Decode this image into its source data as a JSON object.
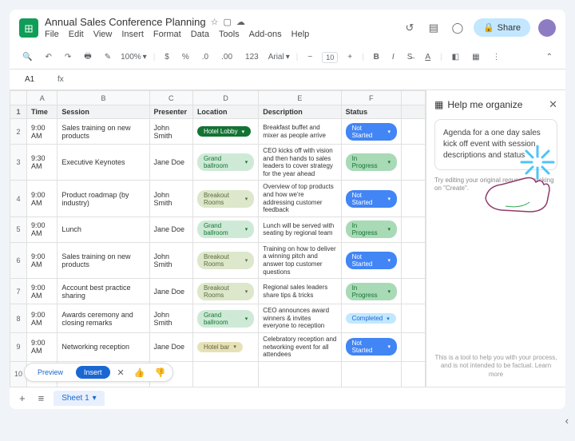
{
  "doc_title": "Annual Sales Conference Planning",
  "menus": [
    "File",
    "Edit",
    "View",
    "Insert",
    "Format",
    "Data",
    "Tools",
    "Add-ons",
    "Help"
  ],
  "share": "Share",
  "zoom": "100%",
  "font": "Arial",
  "fontsize": "10",
  "cellref": "A1",
  "columns": [
    "A",
    "B",
    "C",
    "D",
    "E",
    "F"
  ],
  "headers": {
    "time": "Time",
    "session": "Session",
    "presenter": "Presenter",
    "location": "Location",
    "description": "Description",
    "status": "Status"
  },
  "rows": [
    {
      "n": "2",
      "time": "9:00 AM",
      "session": "Sales training on new products",
      "presenter": "John Smith",
      "loc": "Hotel Lobby",
      "locClass": "loc-lobby",
      "desc": "Breakfast buffet and mixer as people arrive",
      "status": "Not Started",
      "stClass": "st-notstarted"
    },
    {
      "n": "3",
      "time": "9:30 AM",
      "session": "Executive Keynotes",
      "presenter": "Jane Doe",
      "loc": "Grand ballroom",
      "locClass": "loc-ballroom",
      "desc": "CEO kicks off with vision and then hands to sales leaders to cover strategy for the year ahead",
      "status": "In Progress",
      "stClass": "st-inprogress"
    },
    {
      "n": "4",
      "time": "9:00 AM",
      "session": "Product roadmap (by industry)",
      "presenter": "John Smith",
      "loc": "Breakout Rooms",
      "locClass": "loc-breakout",
      "desc": "Overview of top products and how we're addressing customer feedback",
      "status": "Not Started",
      "stClass": "st-notstarted"
    },
    {
      "n": "5",
      "time": "9:00 AM",
      "session": "Lunch",
      "presenter": "Jane Doe",
      "loc": "Grand ballroom",
      "locClass": "loc-ballroom",
      "desc": "Lunch will be served with seating by regional team",
      "status": "In Progress",
      "stClass": "st-inprogress"
    },
    {
      "n": "6",
      "time": "9:00 AM",
      "session": "Sales training on new products",
      "presenter": "John Smith",
      "loc": "Breakout Rooms",
      "locClass": "loc-breakout",
      "desc": "Training on how to deliver a winning pitch and answer top customer questions",
      "status": "Not Started",
      "stClass": "st-notstarted"
    },
    {
      "n": "7",
      "time": "9:00 AM",
      "session": "Account best practice sharing",
      "presenter": "Jane Doe",
      "loc": "Breakout Rooms",
      "locClass": "loc-breakout",
      "desc": "Regional sales leaders share tips & tricks",
      "status": "In Progress",
      "stClass": "st-inprogress"
    },
    {
      "n": "8",
      "time": "9:00 AM",
      "session": "Awards ceremony and closing remarks",
      "presenter": "John Smith",
      "loc": "Grand ballroom",
      "locClass": "loc-ballroom",
      "desc": "CEO announces award winners & invites everyone to reception",
      "status": "Completed",
      "stClass": "st-completed"
    },
    {
      "n": "9",
      "time": "9:00 AM",
      "session": "Networking reception",
      "presenter": "Jane Doe",
      "loc": "Hotel bar",
      "locClass": "loc-bar",
      "desc": "Celebratory reception and networking event for all attendees",
      "status": "Not Started",
      "stClass": "st-notstarted"
    }
  ],
  "extrarow": "10",
  "previewbar": {
    "preview": "Preview",
    "insert": "Insert"
  },
  "sheet_tab": "Sheet 1",
  "sidepanel": {
    "title": "Help me organize",
    "prompt": "Agenda for a one day sales kick off event with session descriptions and status",
    "hint": "Try editing your original request or clicking on \"Create\".",
    "footer": "This is a tool to help you with your process, and is not intended to be factual. Learn more"
  }
}
